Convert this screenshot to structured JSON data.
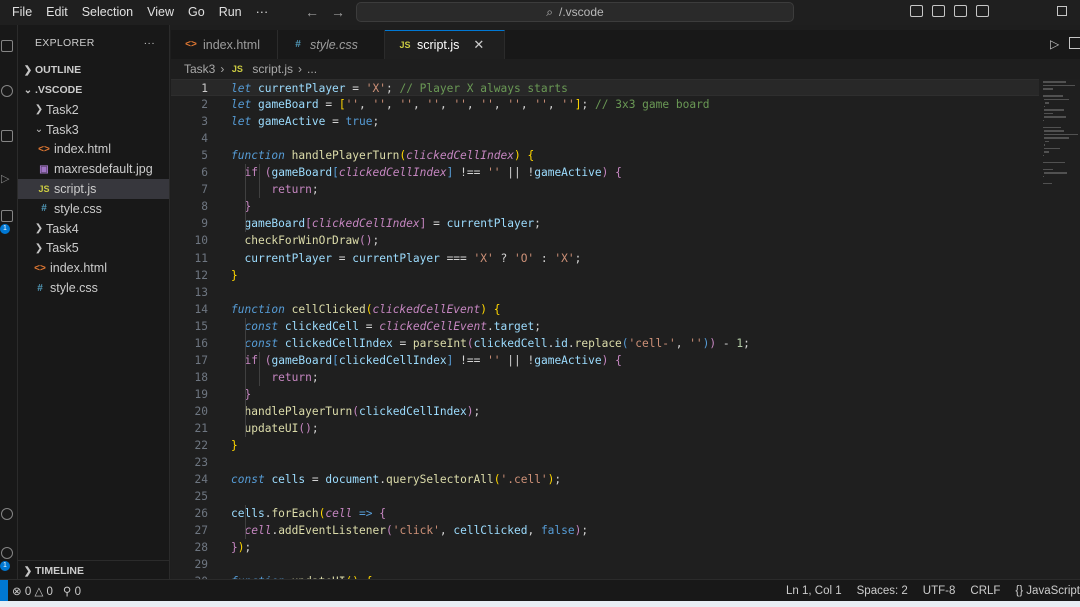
{
  "menu": [
    "File",
    "Edit",
    "Selection",
    "View",
    "Go",
    "Run",
    "···"
  ],
  "command_center": "/.vscode",
  "sidebar": {
    "title": "EXPLORER",
    "more": "···",
    "outline_label": "OUTLINE",
    "root_label": ".VSCODE",
    "timeline_label": "TIMELINE",
    "items": [
      {
        "label": "Task2",
        "type": "folder",
        "open": false,
        "level": 1
      },
      {
        "label": "Task3",
        "type": "folder",
        "open": true,
        "level": 1
      },
      {
        "label": "index.html",
        "type": "html",
        "level": 2
      },
      {
        "label": "maxresdefault.jpg",
        "type": "img",
        "level": 2
      },
      {
        "label": "script.js",
        "type": "js",
        "level": 2,
        "selected": true
      },
      {
        "label": "style.css",
        "type": "css",
        "level": 2
      },
      {
        "label": "Task4",
        "type": "folder",
        "open": false,
        "level": 1
      },
      {
        "label": "Task5",
        "type": "folder",
        "open": false,
        "level": 1
      },
      {
        "label": "index.html",
        "type": "html",
        "level": 1
      },
      {
        "label": "style.css",
        "type": "css",
        "level": 1
      }
    ]
  },
  "tabs": [
    {
      "label": "index.html",
      "icon": "html",
      "active": false,
      "italic": false
    },
    {
      "label": "style.css",
      "icon": "css",
      "active": false,
      "italic": true
    },
    {
      "label": "script.js",
      "icon": "js",
      "active": true,
      "italic": false
    }
  ],
  "breadcrumb": {
    "folder": "Task3",
    "file": "script.js",
    "more": "..."
  },
  "code": {
    "current_line": 1,
    "lines": [
      [
        [
          "k",
          "let"
        ],
        [
          "o",
          " "
        ],
        [
          "v",
          "currentPlayer"
        ],
        [
          "o",
          " = "
        ],
        [
          "s",
          "'X'"
        ],
        [
          "o",
          "; "
        ],
        [
          "c",
          "// Player X always starts"
        ]
      ],
      [
        [
          "k",
          "let"
        ],
        [
          "o",
          " "
        ],
        [
          "v",
          "gameBoard"
        ],
        [
          "o",
          " = "
        ],
        [
          "p",
          "["
        ],
        [
          "s",
          "''"
        ],
        [
          "o",
          ", "
        ],
        [
          "s",
          "''"
        ],
        [
          "o",
          ", "
        ],
        [
          "s",
          "''"
        ],
        [
          "o",
          ", "
        ],
        [
          "s",
          "''"
        ],
        [
          "o",
          ", "
        ],
        [
          "s",
          "''"
        ],
        [
          "o",
          ", "
        ],
        [
          "s",
          "''"
        ],
        [
          "o",
          ", "
        ],
        [
          "s",
          "''"
        ],
        [
          "o",
          ", "
        ],
        [
          "s",
          "''"
        ],
        [
          "o",
          ", "
        ],
        [
          "s",
          "''"
        ],
        [
          "p",
          "]"
        ],
        [
          "o",
          "; "
        ],
        [
          "c",
          "// 3x3 game board"
        ]
      ],
      [
        [
          "k",
          "let"
        ],
        [
          "o",
          " "
        ],
        [
          "v",
          "gameActive"
        ],
        [
          "o",
          " = "
        ],
        [
          "b",
          "true"
        ],
        [
          "o",
          ";"
        ]
      ],
      [],
      [
        [
          "k",
          "function"
        ],
        [
          "o",
          " "
        ],
        [
          "fn",
          "handlePlayerTurn"
        ],
        [
          "p",
          "("
        ],
        [
          "pi",
          "clickedCellIndex"
        ],
        [
          "p",
          ")"
        ],
        [
          "o",
          " "
        ],
        [
          "p",
          "{"
        ]
      ],
      [
        [
          "o",
          "  "
        ],
        [
          "kc",
          "if"
        ],
        [
          "o",
          " "
        ],
        [
          "kc",
          "("
        ],
        [
          "v",
          "gameBoard"
        ],
        [
          "b",
          "["
        ],
        [
          "pi",
          "clickedCellIndex"
        ],
        [
          "b",
          "]"
        ],
        [
          "o",
          " !== "
        ],
        [
          "s",
          "''"
        ],
        [
          "o",
          " || !"
        ],
        [
          "v",
          "gameActive"
        ],
        [
          "kc",
          ")"
        ],
        [
          "o",
          " "
        ],
        [
          "kc",
          "{"
        ]
      ],
      [
        [
          "o",
          "      "
        ],
        [
          "kc",
          "return"
        ],
        [
          "o",
          ";"
        ]
      ],
      [
        [
          "o",
          "  "
        ],
        [
          "kc",
          "}"
        ]
      ],
      [
        [
          "o",
          "  "
        ],
        [
          "v",
          "gameBoard"
        ],
        [
          "kc",
          "["
        ],
        [
          "pi",
          "clickedCellIndex"
        ],
        [
          "kc",
          "]"
        ],
        [
          "o",
          " = "
        ],
        [
          "v",
          "currentPlayer"
        ],
        [
          "o",
          ";"
        ]
      ],
      [
        [
          "o",
          "  "
        ],
        [
          "fn",
          "checkForWinOrDraw"
        ],
        [
          "kc",
          "()"
        ],
        [
          "o",
          ";"
        ]
      ],
      [
        [
          "o",
          "  "
        ],
        [
          "v",
          "currentPlayer"
        ],
        [
          "o",
          " = "
        ],
        [
          "v",
          "currentPlayer"
        ],
        [
          "o",
          " === "
        ],
        [
          "s",
          "'X'"
        ],
        [
          "o",
          " ? "
        ],
        [
          "s",
          "'O'"
        ],
        [
          "o",
          " : "
        ],
        [
          "s",
          "'X'"
        ],
        [
          "o",
          ";"
        ]
      ],
      [
        [
          "p",
          "}"
        ]
      ],
      [],
      [
        [
          "k",
          "function"
        ],
        [
          "o",
          " "
        ],
        [
          "fn",
          "cellClicked"
        ],
        [
          "p",
          "("
        ],
        [
          "pi",
          "clickedCellEvent"
        ],
        [
          "p",
          ")"
        ],
        [
          "o",
          " "
        ],
        [
          "p",
          "{"
        ]
      ],
      [
        [
          "o",
          "  "
        ],
        [
          "k",
          "const"
        ],
        [
          "o",
          " "
        ],
        [
          "v",
          "clickedCell"
        ],
        [
          "o",
          " = "
        ],
        [
          "pi",
          "clickedCellEvent"
        ],
        [
          "o",
          "."
        ],
        [
          "v",
          "target"
        ],
        [
          "o",
          ";"
        ]
      ],
      [
        [
          "o",
          "  "
        ],
        [
          "k",
          "const"
        ],
        [
          "o",
          " "
        ],
        [
          "v",
          "clickedCellIndex"
        ],
        [
          "o",
          " = "
        ],
        [
          "fn",
          "parseInt"
        ],
        [
          "kc",
          "("
        ],
        [
          "v",
          "clickedCell"
        ],
        [
          "o",
          "."
        ],
        [
          "v",
          "id"
        ],
        [
          "o",
          "."
        ],
        [
          "fn",
          "replace"
        ],
        [
          "b",
          "("
        ],
        [
          "s",
          "'cell-'"
        ],
        [
          "o",
          ", "
        ],
        [
          "s",
          "''"
        ],
        [
          "b",
          ")"
        ],
        [
          "kc",
          ")"
        ],
        [
          "o",
          " - "
        ],
        [
          "n",
          "1"
        ],
        [
          "o",
          ";"
        ]
      ],
      [
        [
          "o",
          "  "
        ],
        [
          "kc",
          "if"
        ],
        [
          "o",
          " "
        ],
        [
          "kc",
          "("
        ],
        [
          "v",
          "gameBoard"
        ],
        [
          "b",
          "["
        ],
        [
          "v",
          "clickedCellIndex"
        ],
        [
          "b",
          "]"
        ],
        [
          "o",
          " !== "
        ],
        [
          "s",
          "''"
        ],
        [
          "o",
          " || !"
        ],
        [
          "v",
          "gameActive"
        ],
        [
          "kc",
          ")"
        ],
        [
          "o",
          " "
        ],
        [
          "kc",
          "{"
        ]
      ],
      [
        [
          "o",
          "      "
        ],
        [
          "kc",
          "return"
        ],
        [
          "o",
          ";"
        ]
      ],
      [
        [
          "o",
          "  "
        ],
        [
          "kc",
          "}"
        ]
      ],
      [
        [
          "o",
          "  "
        ],
        [
          "fn",
          "handlePlayerTurn"
        ],
        [
          "kc",
          "("
        ],
        [
          "v",
          "clickedCellIndex"
        ],
        [
          "kc",
          ")"
        ],
        [
          "o",
          ";"
        ]
      ],
      [
        [
          "o",
          "  "
        ],
        [
          "fn",
          "updateUI"
        ],
        [
          "kc",
          "()"
        ],
        [
          "o",
          ";"
        ]
      ],
      [
        [
          "p",
          "}"
        ]
      ],
      [],
      [
        [
          "k",
          "const"
        ],
        [
          "o",
          " "
        ],
        [
          "v",
          "cells"
        ],
        [
          "o",
          " = "
        ],
        [
          "v",
          "document"
        ],
        [
          "o",
          "."
        ],
        [
          "fn",
          "querySelectorAll"
        ],
        [
          "p",
          "("
        ],
        [
          "s",
          "'.cell'"
        ],
        [
          "p",
          ")"
        ],
        [
          "o",
          ";"
        ]
      ],
      [],
      [
        [
          "v",
          "cells"
        ],
        [
          "o",
          "."
        ],
        [
          "fn",
          "forEach"
        ],
        [
          "p",
          "("
        ],
        [
          "pi",
          "cell"
        ],
        [
          "o",
          " "
        ],
        [
          "k",
          "=>"
        ],
        [
          "o",
          " "
        ],
        [
          "kc",
          "{"
        ]
      ],
      [
        [
          "o",
          "  "
        ],
        [
          "pi",
          "cell"
        ],
        [
          "o",
          "."
        ],
        [
          "fn",
          "addEventListener"
        ],
        [
          "kc",
          "("
        ],
        [
          "s",
          "'click'"
        ],
        [
          "o",
          ", "
        ],
        [
          "v",
          "cellClicked"
        ],
        [
          "o",
          ", "
        ],
        [
          "b",
          "false"
        ],
        [
          "kc",
          ")"
        ],
        [
          "o",
          ";"
        ]
      ],
      [
        [
          "kc",
          "}"
        ],
        [
          "p",
          ")"
        ],
        [
          "o",
          ";"
        ]
      ],
      [],
      [
        [
          "k",
          "function"
        ],
        [
          "o",
          " "
        ],
        [
          "fn",
          "updateUI"
        ],
        [
          "p",
          "()"
        ],
        [
          "o",
          " "
        ],
        [
          "p",
          "{"
        ]
      ]
    ]
  },
  "status": {
    "errors": "0",
    "warnings": "0",
    "ports": "0",
    "position": "Ln 1, Col 1",
    "spaces": "Spaces: 2",
    "encoding": "UTF-8",
    "eol": "CRLF",
    "language": "{} JavaScript"
  },
  "accent_color": "#0078d4",
  "badge_count": "1"
}
